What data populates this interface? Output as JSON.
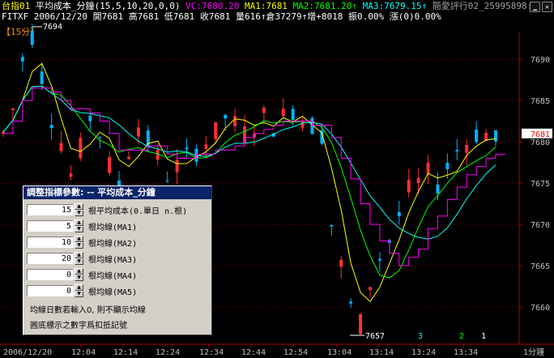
{
  "header": {
    "segments": [
      {
        "text": "台指01 ",
        "color": "#ffff00"
      },
      {
        "text": "平均成本_分鐘(15,5,10,20,0,0) ",
        "color": "#ffffff"
      },
      {
        "text": "VC:7680.20 ",
        "color": "#ff00ff"
      },
      {
        "text": "MA1:7681 ",
        "color": "#ffff00"
      },
      {
        "text": "MA2:7681.20↑ ",
        "color": "#00ff00"
      },
      {
        "text": "MA3:7679.15↑",
        "color": "#00ffff"
      },
      {
        "text": "    簡愛評行02_25995898:2",
        "color": "#a0a0a0"
      }
    ],
    "quote_line": "FITXF 2006/12/20 開7681 高7681 低7681 收7681 量616↑倉37279↑增+8018 振0.00% 漲(0)0.00%",
    "period": "【15分】"
  },
  "chart": {
    "y_ticks": [
      "7690",
      "7685",
      "7680",
      "7675",
      "7670",
      "7665",
      "7660"
    ],
    "x_ticks": [
      "2006/12/20",
      "12:04",
      "12:14",
      "12:24",
      "12:34",
      "12:44",
      "12:54",
      "13:04",
      "13:14",
      "13:24",
      "13:34",
      "1分鐘"
    ],
    "high_label": "7694",
    "low_label": "7657",
    "last_price": "7681",
    "bottom_markers": [
      "3",
      "2",
      "1"
    ]
  },
  "dialog": {
    "title": "調整指標參數: -- 平均成本_分鐘",
    "params": [
      {
        "value": "15",
        "label": "根平均成本(0.單日 n.根)"
      },
      {
        "value": "5",
        "label": "根均線(MA1)"
      },
      {
        "value": "10",
        "label": "根均線(MA2)"
      },
      {
        "value": "20",
        "label": "根均線(MA3)"
      },
      {
        "value": "0",
        "label": "根均線(MA4)"
      },
      {
        "value": "0",
        "label": "根均線(MA5)"
      }
    ],
    "note1": "均線日數若輸入0, 則不顯示均線",
    "note2": "圓底標示之數字爲扣抵記號"
  },
  "colors": {
    "up": "#ff3030",
    "down": "#00b4ff",
    "grid": "#800000",
    "axis": "#b00000",
    "vc": "#ff00ff",
    "ma1": "#ffff00",
    "ma2": "#00ff00",
    "ma3": "#00ffff"
  }
}
